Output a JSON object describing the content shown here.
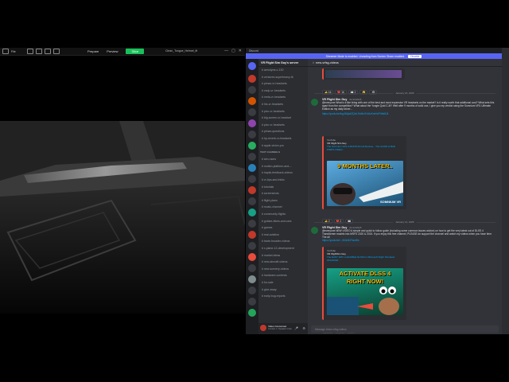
{
  "slicer": {
    "menu_label": "File",
    "tabs": [
      "Prepare",
      "Preview",
      "Slice"
    ],
    "file_name": "Clean_Tongue_Helmet_fit",
    "window_controls": [
      "—",
      "▢",
      "✕"
    ]
  },
  "discord": {
    "window_title": "Discord",
    "banner": {
      "text": "Streamer Mode is enabled. Unmuting from Screen Share enabled.",
      "button": "Disable"
    },
    "server_name": "VR Flight Sim Guy's server",
    "channel_title": "new-vrfsg-videos",
    "channels": [
      {
        "type": "channel",
        "name": "aerodyne-c-130"
      },
      {
        "type": "channel",
        "name": "ventures-superheavy-fb"
      },
      {
        "type": "channel",
        "name": "pimax-vr-headsets"
      },
      {
        "type": "channel",
        "name": "varjo-vr-headsets"
      },
      {
        "type": "channel",
        "name": "meta-vr-headsets"
      },
      {
        "type": "channel",
        "name": "htc-vr-headsets"
      },
      {
        "type": "channel",
        "name": "pico-vr-headsets"
      },
      {
        "type": "channel",
        "name": "big-screen-vr-headset"
      },
      {
        "type": "channel",
        "name": "pico-vr-headsets"
      },
      {
        "type": "channel",
        "name": "pimax-questions"
      },
      {
        "type": "channel",
        "name": "hp-reverb-vr-headsets"
      },
      {
        "type": "channel",
        "name": "apple-vision-pro"
      },
      {
        "type": "category",
        "name": "TEXT CHANNELS"
      },
      {
        "type": "channel",
        "name": "sim-races"
      },
      {
        "type": "channel",
        "name": "motion-platform-and-..."
      },
      {
        "type": "channel",
        "name": "haptic-feedback-videos"
      },
      {
        "type": "channel",
        "name": "vr-tips-and-tricks"
      },
      {
        "type": "channel",
        "name": "tutorials"
      },
      {
        "type": "channel",
        "name": "screenshots"
      },
      {
        "type": "channel",
        "name": "flight-plans"
      },
      {
        "type": "channel",
        "name": "music-channel"
      },
      {
        "type": "channel",
        "name": "community-flights"
      },
      {
        "type": "channel",
        "name": "guitars-bikes-and-cars"
      },
      {
        "type": "channel",
        "name": "games"
      },
      {
        "type": "channel",
        "name": "real-aviation"
      },
      {
        "type": "channel",
        "name": "trade-broader-videos"
      },
      {
        "type": "channel",
        "name": "x-plane-12-development"
      },
      {
        "type": "channel",
        "name": "market-ideas"
      },
      {
        "type": "channel",
        "name": "new-aircraft-videos"
      },
      {
        "type": "channel",
        "name": "new-scenery-videos"
      },
      {
        "type": "channel",
        "name": "hardware-contests"
      },
      {
        "type": "channel",
        "name": "for-sale"
      },
      {
        "type": "channel",
        "name": "give-away"
      },
      {
        "type": "channel",
        "name": "early-bug-reports"
      }
    ],
    "user": {
      "name": "Video Concerned",
      "status": "Contact 1 / Speaker Invite"
    },
    "messages": [
      {
        "date": "January 16, 2025",
        "author": "VR Flight Sim Guy",
        "time": "01/16/2025",
        "text": "@everyone What is it like living with one of the best and most expensive VR headsets on the market? Is it really worth that additional cost? What sets this apart from the competition? What about the Yongie Quid C-M? Well after 9 months of solid use, I give you my verdict using the Somnium VR1 Ultimate Edition as my daily driver...",
        "link": "https://youtu.be/4qy0l4ja4ZQ/si-9m5w7r4AvKmHnFHbk8J4",
        "embed_provider": "YouTube",
        "embed_channel": "VR Flight Sim Guy",
        "embed_title": "The Somnium VR1 9 MONTHS Full Review... The GOOD & BAD PIMPS VIDEO...",
        "thumb_caption": "9 MONTHS LATER..",
        "thumb_brand": "SOMNIUM VR",
        "reactions": [
          "👍 2",
          "❤️ 2",
          "👀"
        ]
      },
      {
        "date": "January 12, 2025",
        "author": "VR Flight Sim Guy",
        "time": "01/12/2025",
        "text": "@everyone NEW VIDEO A simple and quick to follow guide (including some common issues advice) on how to get the very latest out of DLSS 4 Transformer models into MSFS 2020 & 2024. If you enjoy this free channel, PLEASE do support the channel and watch my videos when you have time. The all",
        "link": "https://youtu.be/...0t4LM4TwoWs",
        "embed_provider": "YouTube",
        "embed_channel": "VR FlightSim Guy",
        "embed_title": "The EASY WAY to ENABLE DLSS4 in Microsoft Flight Simulator 2024/2020...",
        "thumb_caption_1": "ACTIVATE DLSS 4",
        "thumb_caption_2": "RIGHT NOW!",
        "reactions": [
          "❤️ 16",
          "👍 3",
          "👀"
        ]
      }
    ],
    "top_reactions": [
      "👍 16",
      "❤️ 16",
      "👀 2",
      "😮",
      "👁"
    ],
    "composer_placeholder": "Message #new-vrfsg-videos"
  },
  "colors": {
    "slice_green": "#19c05a",
    "discord_blurple": "#5865f2",
    "embed_red": "#e74c3c"
  }
}
